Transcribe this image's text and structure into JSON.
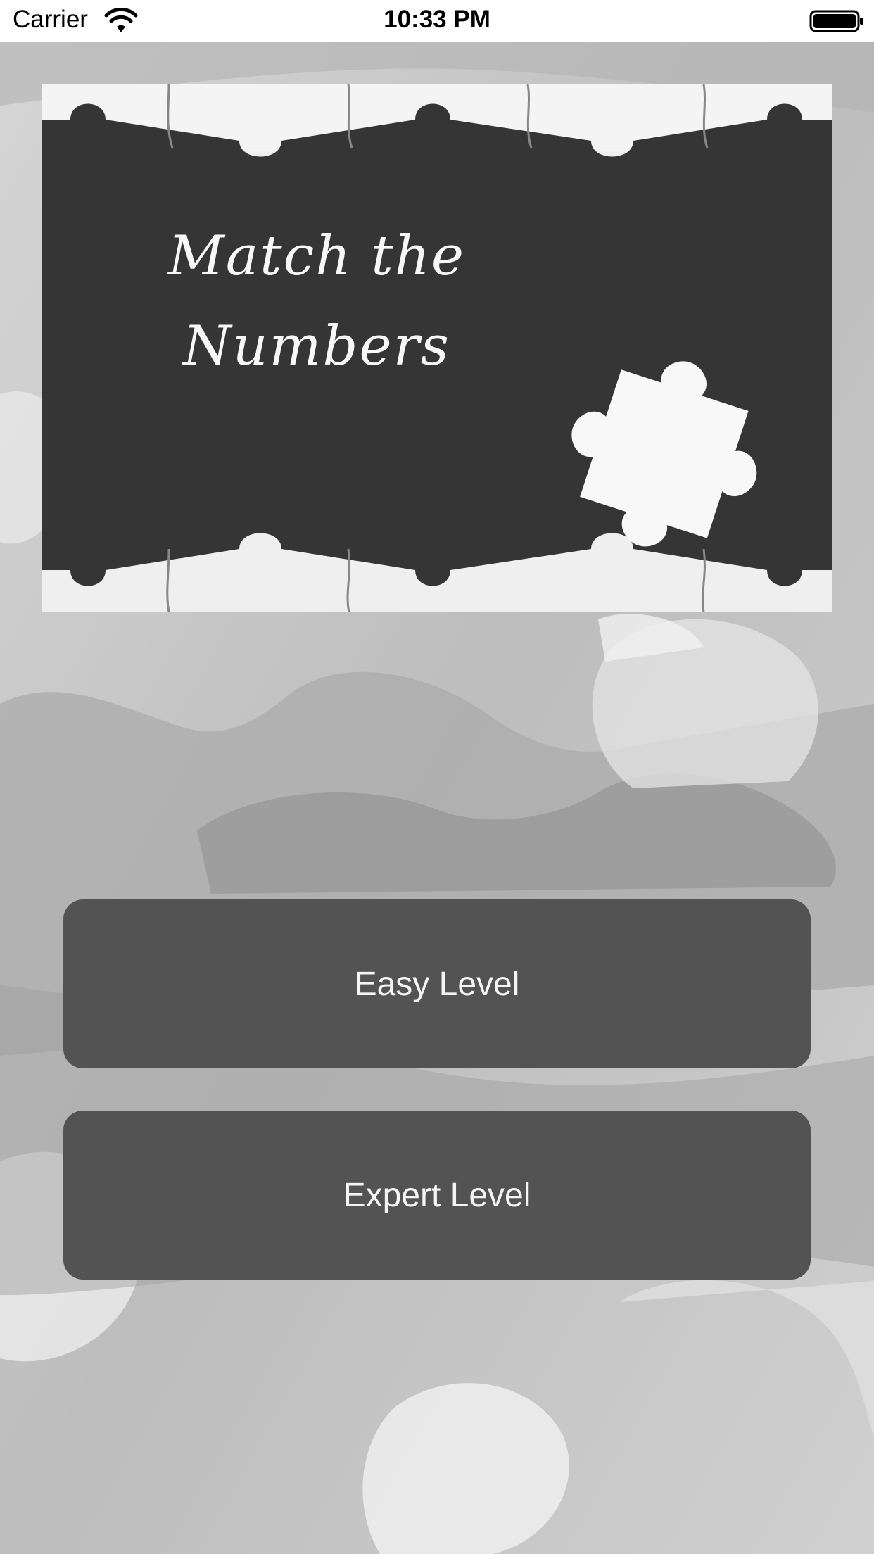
{
  "status_bar": {
    "carrier": "Carrier",
    "time": "10:33 PM",
    "wifi_icon": "wifi-icon",
    "battery_icon": "battery-icon"
  },
  "banner": {
    "title_line1": "Match the",
    "title_line2": "Numbers",
    "puzzle_icon": "puzzle-piece-icon"
  },
  "buttons": {
    "easy_label": "Easy Level",
    "expert_label": "Expert Level"
  },
  "colors": {
    "button_bg": "#535353",
    "banner_bg": "#3a3a3a",
    "button_text": "#f5f5f5"
  }
}
